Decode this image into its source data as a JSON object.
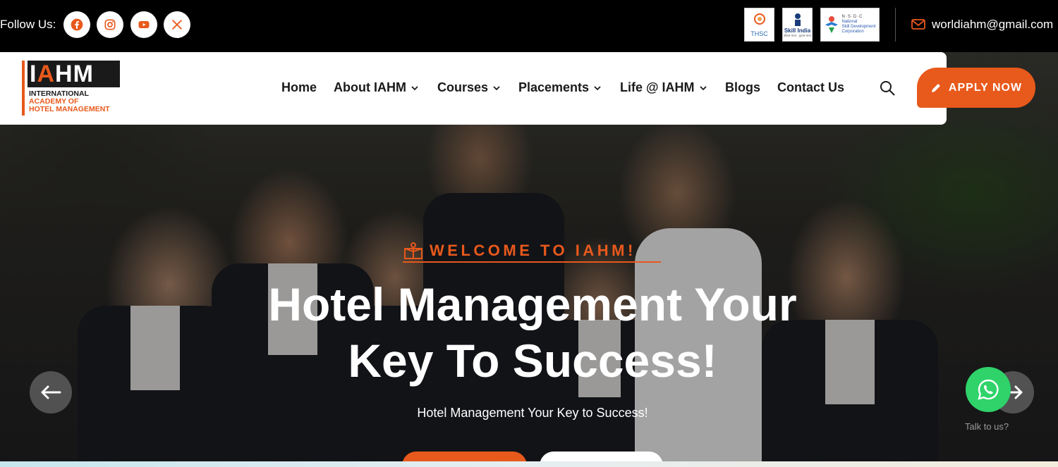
{
  "topbar": {
    "follow_label": "Follow Us:",
    "socials": [
      "facebook-icon",
      "instagram-icon",
      "youtube-icon",
      "x-icon"
    ],
    "partners": [
      {
        "name": "THSC"
      },
      {
        "name": "Skill India",
        "tagline": "कौशल भारत - कुशल भारत"
      },
      {
        "name": "N·S·D·C",
        "line1": "National",
        "line2": "Skill Development",
        "line3": "Corporation"
      }
    ],
    "email": "worldiahm@gmail.com"
  },
  "logo": {
    "mark_left": "I",
    "mark_accent": "A",
    "mark_right": "HM",
    "line1": "INTERNATIONAL",
    "line2": "ACADEMY OF",
    "line3": "HOTEL MANAGEMENT"
  },
  "nav": {
    "items": [
      {
        "label": "Home",
        "dropdown": false
      },
      {
        "label": "About IAHM",
        "dropdown": true
      },
      {
        "label": "Courses",
        "dropdown": true
      },
      {
        "label": "Placements",
        "dropdown": true
      },
      {
        "label": "Life @ IAHM",
        "dropdown": true
      },
      {
        "label": "Blogs",
        "dropdown": false
      },
      {
        "label": "Contact Us",
        "dropdown": false
      }
    ],
    "apply_label": "APPLY NOW"
  },
  "hero": {
    "welcome": "WELCOME TO IAHM!",
    "headline_line1": "Hotel Management Your",
    "headline_line2": "Key To Success!",
    "subtitle": "Hotel Management Your Key to Success!"
  },
  "chat": {
    "label": "Talk to us?"
  },
  "colors": {
    "accent": "#e8591c",
    "whatsapp": "#2fd36a",
    "social_icon": "#e8591c"
  }
}
